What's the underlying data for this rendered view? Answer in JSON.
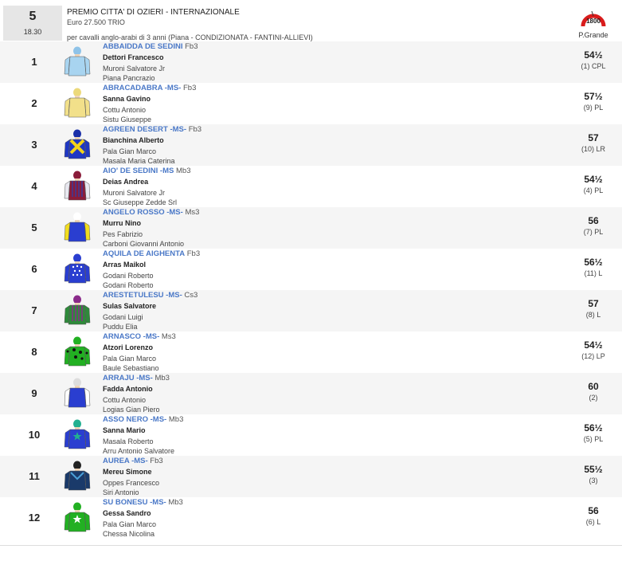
{
  "race": {
    "number": "5",
    "time": "18.30",
    "title": "PREMIO CITTA' DI OZIERI - INTERNAZIONALE",
    "prize": "Euro 27.500 TRIO",
    "conditions": "per cavalli anglo-arabi di 3 anni (Piana -  CONDIZIONATA  - FANTINI-ALLIEVI)",
    "distance": "1800",
    "track": "P.Grande"
  },
  "colors": {
    "horse_name": "#4a78c7",
    "row_alt": "#f5f5f5",
    "track_arc": "#d91c1c"
  },
  "runners": [
    {
      "num": "1",
      "name": "ABBAIDDA DE SEDINI",
      "info": "Fb3",
      "jockey": "Dettori Francesco",
      "trainer": "Muroni Salvatore Jr",
      "owner": "Piana Pancrazio",
      "weight": "54½",
      "slot": "(1) CPL",
      "silks": {
        "cap": "#8fc3e8",
        "body": "#a8d4f0",
        "sleeve": "#a8d4f0",
        "pattern": "plain",
        "accent": "#ffffff"
      }
    },
    {
      "num": "2",
      "name": "ABRACADABRA -MS-",
      "info": "Fb3",
      "jockey": "Sanna Gavino",
      "trainer": "Cottu Antonio",
      "owner": "Sistu Giuseppe",
      "weight": "57½",
      "slot": "(9) PL",
      "silks": {
        "cap": "#ecd97a",
        "body": "#f2e08a",
        "sleeve": "#f2e08a",
        "pattern": "plain",
        "accent": "#e8c94a"
      }
    },
    {
      "num": "3",
      "name": "AGREEN DESERT -MS-",
      "info": "Fb3",
      "jockey": "Bianchina Alberto",
      "trainer": "Pala Gian Marco",
      "owner": "Masala Maria Caterina",
      "weight": "57",
      "slot": "(10) LR",
      "silks": {
        "cap": "#1b2fa8",
        "body": "#1f37c4",
        "sleeve": "#1f37c4",
        "pattern": "cross",
        "accent": "#f3d21a"
      }
    },
    {
      "num": "4",
      "name": "AIO' DE SEDINI -MS",
      "info": "Mb3",
      "jockey": "Deias Andrea",
      "trainer": "Muroni Salvatore Jr",
      "owner": "Sc Giuseppe Zedde Srl",
      "weight": "54½",
      "slot": "(4) PL",
      "silks": {
        "cap": "#8a1c3a",
        "body": "#8a1c3a",
        "sleeve": "#e8e8f0",
        "pattern": "stripes",
        "accent": "#3a3a9a"
      }
    },
    {
      "num": "5",
      "name": "ANGELO ROSSO -MS-",
      "info": "Ms3",
      "jockey": "Murru Nino",
      "trainer": "Pes Fabrizio",
      "owner": "Carboni Giovanni Antonio",
      "weight": "56",
      "slot": "(7) PL",
      "silks": {
        "cap": "#ffffff",
        "body": "#2a3ed0",
        "sleeve": "#f1dc1f",
        "pattern": "plain",
        "accent": "#ffffff"
      }
    },
    {
      "num": "6",
      "name": "AQUILA DE AIGHENTA",
      "info": "Fb3",
      "jockey": "Arras Maikol",
      "trainer": "Godani Roberto",
      "owner": "Godani Roberto",
      "weight": "56½",
      "slot": "(11) L",
      "silks": {
        "cap": "#2a3ed0",
        "body": "#2a3ed0",
        "sleeve": "#2a3ed0",
        "pattern": "dots",
        "accent": "#ffffff"
      }
    },
    {
      "num": "7",
      "name": "ARESTETULESU -MS-",
      "info": "Cs3",
      "jockey": "Sulas Salvatore",
      "trainer": "Godani Luigi",
      "owner": "Puddu Elia",
      "weight": "57",
      "slot": "(8) L",
      "silks": {
        "cap": "#8a2a8a",
        "body": "#2e8a3a",
        "sleeve": "#2e8a3a",
        "pattern": "stripes",
        "accent": "#8a2a8a"
      }
    },
    {
      "num": "8",
      "name": "ARNASCO -MS-",
      "info": "Ms3",
      "jockey": "Atzori Lorenzo",
      "trainer": "Pala Gian Marco",
      "owner": "Baule Sebastiano",
      "weight": "54½",
      "slot": "(12) LP",
      "silks": {
        "cap": "#22b022",
        "body": "#22b022",
        "sleeve": "#22b022",
        "pattern": "spots",
        "accent": "#111111"
      }
    },
    {
      "num": "9",
      "name": "ARRAJU -MS-",
      "info": "Mb3",
      "jockey": "Fadda Antonio",
      "trainer": "Cottu Antonio",
      "owner": "Logias Gian Piero",
      "weight": "60",
      "slot": "(2)",
      "silks": {
        "cap": "#dddddd",
        "body": "#2a3ed0",
        "sleeve": "#ffffff",
        "pattern": "plain",
        "accent": "#2a3ed0"
      }
    },
    {
      "num": "10",
      "name": "ASSO NERO -MS-",
      "info": "Mb3",
      "jockey": "Sanna Mario",
      "trainer": "Masala Roberto",
      "owner": "Arru Antonio Salvatore",
      "weight": "56½",
      "slot": "(5) PL",
      "silks": {
        "cap": "#22b090",
        "body": "#2a3ed0",
        "sleeve": "#2a3ed0",
        "pattern": "star",
        "accent": "#22b090"
      }
    },
    {
      "num": "11",
      "name": "AUREA -MS-",
      "info": "Fb3",
      "jockey": "Mereu Simone",
      "trainer": "Oppes Francesco",
      "owner": "Siri Antonio",
      "weight": "55½",
      "slot": "(3)",
      "silks": {
        "cap": "#222222",
        "body": "#1a3a6a",
        "sleeve": "#1a3a6a",
        "pattern": "chevron",
        "accent": "#4aa0d8"
      }
    },
    {
      "num": "12",
      "name": "SU BONESU -MS-",
      "info": "Mb3",
      "jockey": "Gessa Sandro",
      "trainer": "Pala Gian Marco",
      "owner": "Chessa Nicolina",
      "weight": "56",
      "slot": "(6) L",
      "silks": {
        "cap": "#22b022",
        "body": "#22b022",
        "sleeve": "#22b022",
        "pattern": "star",
        "accent": "#ffffff"
      }
    }
  ]
}
